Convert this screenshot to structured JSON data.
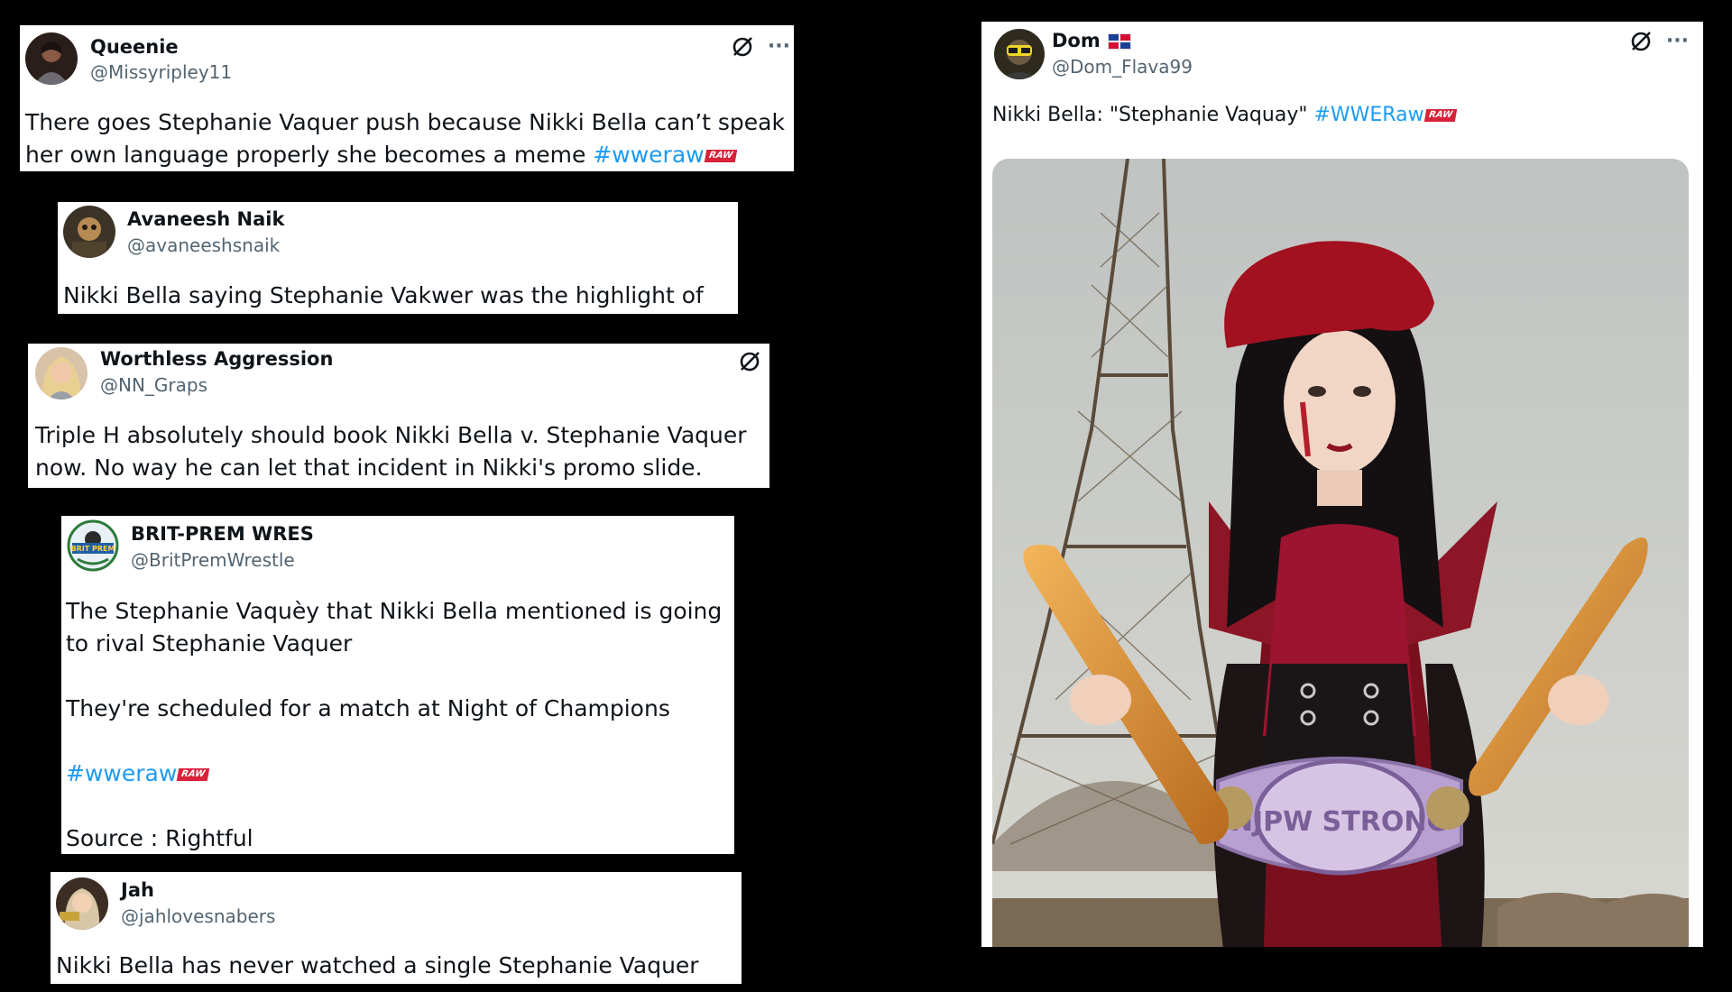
{
  "tweets": [
    {
      "name": "Queenie",
      "handle": "@Missyripley11",
      "text_1": "There goes Stephanie Vaquer push because Nikki Bella can’t speak her own language properly she becomes a meme",
      "hashtag": "#wweraw",
      "raw_badge": "RAW"
    },
    {
      "name": "Avaneesh Naik",
      "handle": "@avaneeshsnaik",
      "text_1": "Nikki Bella saying Stephanie Vakwer was the highlight of the night."
    },
    {
      "name": "Worthless Aggression",
      "handle": "@NN_Graps",
      "text_1": "Triple H absolutely should book Nikki Bella v. Stephanie Vaquer now. No way he can let that incident in Nikki's promo slide."
    },
    {
      "name": "BRIT-PREM WRES",
      "handle": "@BritPremWrestle",
      "avatar_label": "BRIT PREM",
      "text_1": "The Stephanie Vaquèy that Nikki Bella mentioned is going to rival Stephanie Vaquer",
      "text_2": "They're scheduled for a match at Night of Champions",
      "hashtag": "#wweraw",
      "raw_badge": "RAW",
      "text_3": "Source : Rightful"
    },
    {
      "name": "Jah",
      "handle": "@jahlovesnabers",
      "text_1": "Nikki Bella has never watched a single Stephanie Vaquer match btw"
    },
    {
      "name": "Dom",
      "handle": "@Dom_Flava99",
      "text_1": "Nikki Bella: \"Stephanie Vaquay\"",
      "hashtag": "#WWERaw",
      "raw_badge": "RAW",
      "belt_text": "NJPW STRONG"
    }
  ],
  "more_glyph": "···",
  "colors": {
    "link": "#1d9bf0",
    "handle": "#536471",
    "text": "#0f1419",
    "raw_red": "#d9213a"
  },
  "icons": [
    "grok-icon",
    "more-options-icon",
    "dominican-flag-icon",
    "raw-logo-icon"
  ]
}
